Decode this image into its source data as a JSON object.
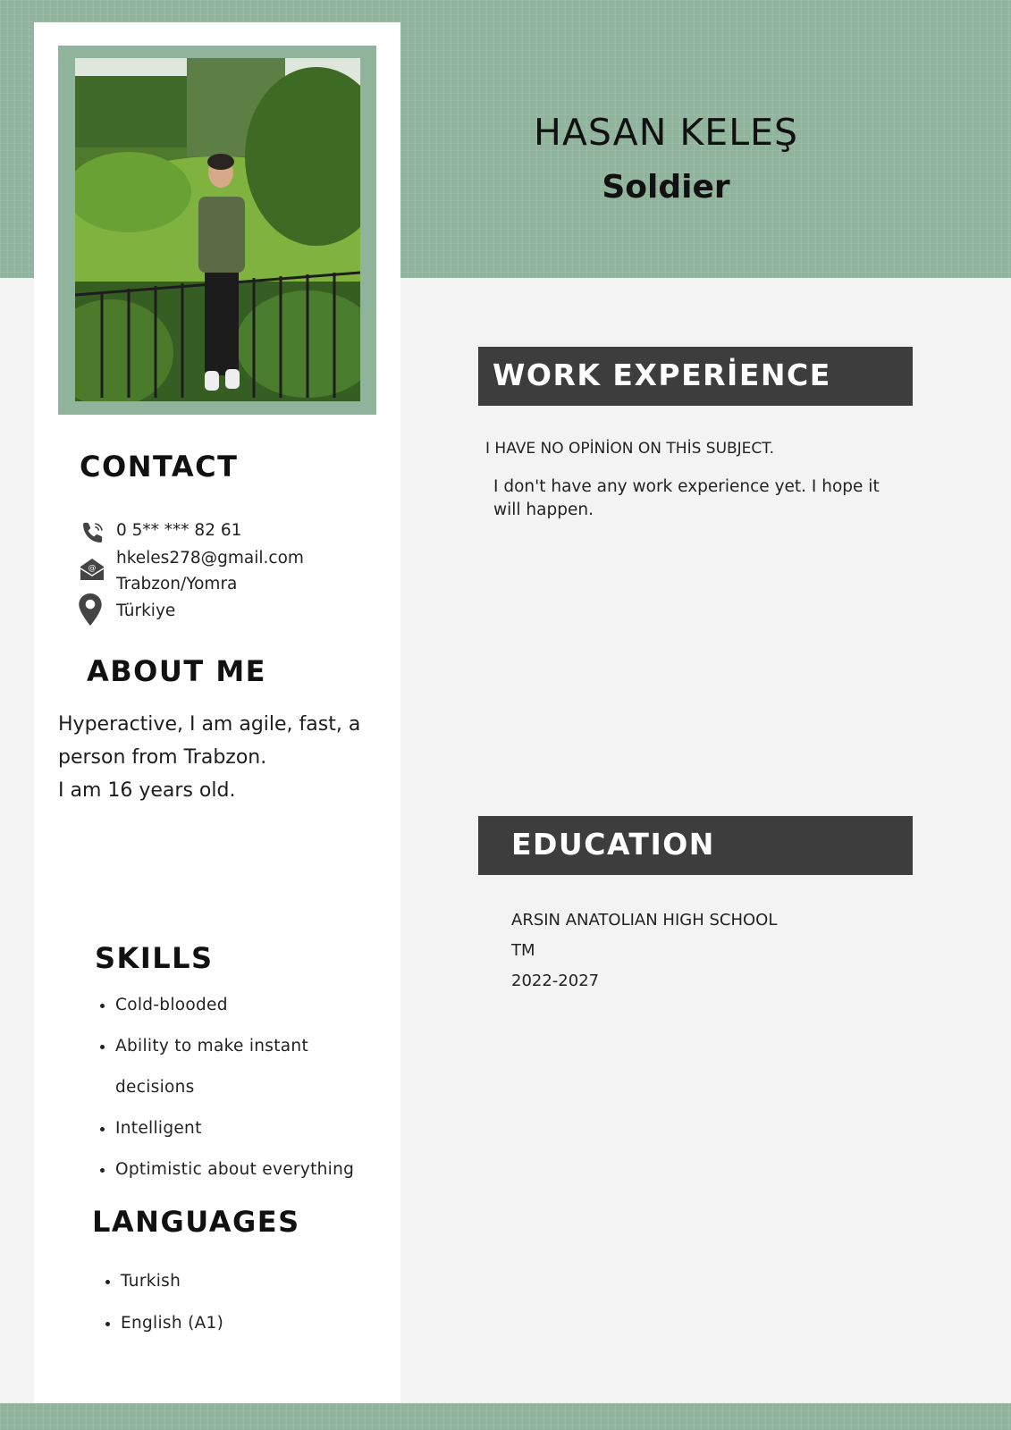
{
  "header": {
    "name": "HASAN KELEŞ",
    "job_title": "Soldier"
  },
  "contact": {
    "heading": "CONTACT",
    "phone": "0 5** *** 82 61",
    "email": "hkeles278@gmail.com",
    "city": "Trabzon/Yomra",
    "country": "Türkiye"
  },
  "about": {
    "heading": "ABOUT ME",
    "lines": [
      "Hyperactive, I am agile, fast, a",
      "person from Trabzon.",
      "I am 16 years old."
    ]
  },
  "skills": {
    "heading": "SKILLS",
    "items": [
      "Cold-blooded",
      "Ability to make instant",
      "Intelligent",
      "Optimistic about everything"
    ],
    "item_continuation": "decisions"
  },
  "languages": {
    "heading": "LANGUAGES",
    "items": [
      "Turkish",
      "English (A1)"
    ]
  },
  "work": {
    "heading": "WORK EXPERİENCE",
    "subtitle": "I HAVE NO OPİNİON ON THİS SUBJECT.",
    "description_lines": [
      "I don't have any work experience yet. I hope it",
      "will happen."
    ]
  },
  "education": {
    "heading": "EDUCATION",
    "school": "ARSIN ANATOLIAN HIGH SCHOOL",
    "program": "TM",
    "years": "2022-2027"
  },
  "icons": {
    "phone": "phone-icon",
    "email": "email-icon",
    "location": "location-pin-icon"
  },
  "colors": {
    "sage_green": "#8fb39b",
    "dark_bar": "#3d3d3d",
    "page_bg": "#f3f3f3",
    "card_bg": "#ffffff"
  }
}
